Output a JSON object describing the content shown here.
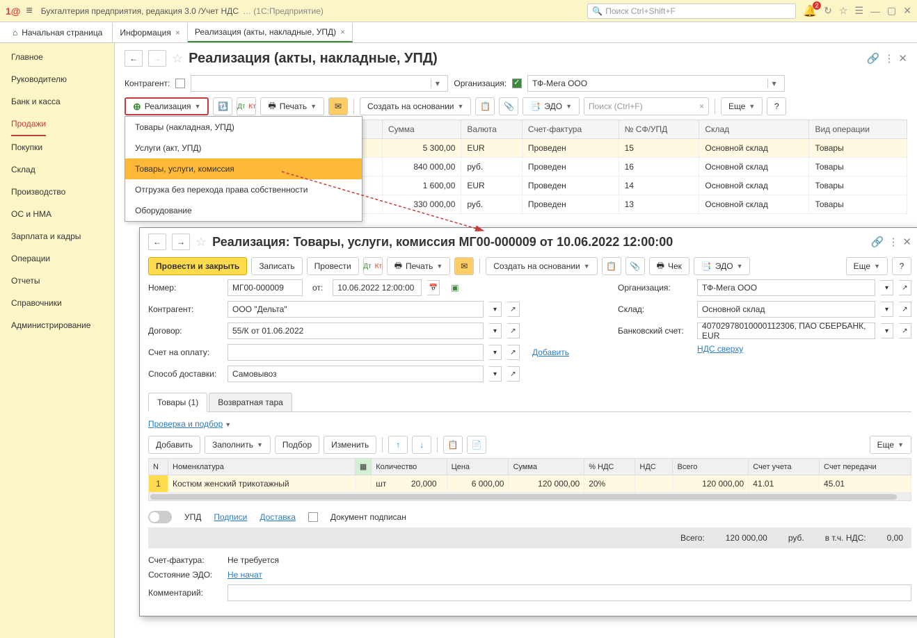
{
  "topbar": {
    "app_title": "Бухгалтерия предприятия, редакция 3.0 /Учет НДС",
    "suffix": "… (1С:Предприятие)",
    "search_placeholder": "Поиск Ctrl+Shift+F",
    "badge": "2"
  },
  "tabs": {
    "home": "Начальная страница",
    "tab1": "Информация",
    "tab2": "Реализация (акты, накладные, УПД)"
  },
  "sidebar": {
    "items": [
      "Главное",
      "Руководителю",
      "Банк и касса",
      "Продажи",
      "Покупки",
      "Склад",
      "Производство",
      "ОС и НМА",
      "Зарплата и кадры",
      "Операции",
      "Отчеты",
      "Справочники",
      "Администрирование"
    ]
  },
  "page": {
    "title": "Реализация (акты, накладные, УПД)",
    "filter_counterparty": "Контрагент:",
    "filter_org": "Организация:",
    "org_value": "ТФ-Мега ООО"
  },
  "toolbar1": {
    "realizatsia": "Реализация",
    "print": "Печать",
    "create_based": "Создать на основании",
    "edo": "ЭДО",
    "search_placeholder": "Поиск (Ctrl+F)",
    "more": "Еще"
  },
  "dropdown": {
    "items": [
      "Товары (накладная, УПД)",
      "Услуги (акт, УПД)",
      "Товары, услуги, комиссия",
      "Отгрузка без перехода права собственности",
      "Оборудование"
    ]
  },
  "list_table": {
    "headers": {
      "sum": "Сумма",
      "currency": "Валюта",
      "invoice": "Счет-фактура",
      "sf": "№ СФ/УПД",
      "warehouse": "Склад",
      "optype": "Вид операции"
    },
    "rows": [
      {
        "sum": "5 300,00",
        "cur": "EUR",
        "inv": "Проведен",
        "sf": "15",
        "wh": "Основной склад",
        "op": "Товары"
      },
      {
        "sum": "840 000,00",
        "cur": "руб.",
        "inv": "Проведен",
        "sf": "16",
        "wh": "Основной склад",
        "op": "Товары"
      },
      {
        "sum": "1 600,00",
        "cur": "EUR",
        "inv": "Проведен",
        "sf": "14",
        "wh": "Основной склад",
        "op": "Товары"
      },
      {
        "sum": "330 000,00",
        "cur": "руб.",
        "inv": "Проведен",
        "sf": "13",
        "wh": "Основной склад",
        "op": "Товары"
      }
    ]
  },
  "doc": {
    "title": "Реализация: Товары, услуги, комиссия МГ00-000009 от 10.06.2022 12:00:00",
    "post_close": "Провести и закрыть",
    "record": "Записать",
    "post": "Провести",
    "print": "Печать",
    "create_based": "Создать на основании",
    "check": "Чек",
    "edo": "ЭДО",
    "more": "Еще",
    "labels": {
      "number": "Номер:",
      "from": "от:",
      "org": "Организация:",
      "counterparty": "Контрагент:",
      "warehouse": "Склад:",
      "contract": "Договор:",
      "bank": "Банковский счет:",
      "invoice_for": "Счет на оплату:",
      "add": "Добавить",
      "vat_top": "НДС сверху",
      "delivery": "Способ доставки:"
    },
    "values": {
      "number": "МГ00-000009",
      "date": "10.06.2022 12:00:00",
      "org": "ТФ-Мега ООО",
      "counterparty": "ООО \"Дельта\"",
      "warehouse": "Основной склад",
      "contract": "55/К от 01.06.2022",
      "bank": "40702978010000112306, ПАО СБЕРБАНК, EUR",
      "delivery": "Самовывоз"
    },
    "tabs": {
      "goods": "Товары (1)",
      "pack": "Возвратная тара"
    },
    "check_pick": "Проверка и подбор",
    "item_toolbar": {
      "add": "Добавить",
      "fill": "Заполнить",
      "pick": "Подбор",
      "change": "Изменить",
      "more": "Еще"
    },
    "item_headers": {
      "n": "N",
      "nomen": "Номенклатура",
      "qty": "Количество",
      "price": "Цена",
      "sum": "Сумма",
      "vat_pct": "% НДС",
      "vat": "НДС",
      "total": "Всего",
      "acc": "Счет учета",
      "transfer": "Счет передачи"
    },
    "item_row": {
      "n": "1",
      "nomen": "Костюм женский трикотажный",
      "qty": "20,000",
      "unit": "шт",
      "price": "6 000,00",
      "sum": "120 000,00",
      "vat_pct": "20%",
      "vat": "",
      "total": "120 000,00",
      "acc": "41.01",
      "transfer": "45.01"
    },
    "footer": {
      "upd": "УПД",
      "signs": "Подписи",
      "delivery": "Доставка",
      "signed": "Документ подписан"
    },
    "totals": {
      "total_lbl": "Всего:",
      "total_val": "120 000,00",
      "cur": "руб.",
      "vat_lbl": "в т.ч. НДС:",
      "vat_val": "0,00"
    },
    "sf_label": "Счет-фактура:",
    "sf_val": "Не требуется",
    "edo_label": "Состояние ЭДО:",
    "edo_val": "Не начат",
    "comment": "Комментарий:"
  }
}
